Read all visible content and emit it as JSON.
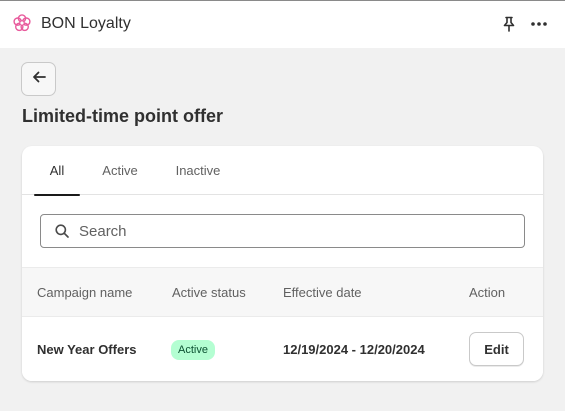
{
  "app": {
    "title": "BON Loyalty",
    "logo_icon": "flower-icon",
    "actions": [
      "pin-icon",
      "more-horizontal-icon"
    ]
  },
  "page": {
    "back_icon": "arrow-left-icon",
    "title": "Limited-time point offer"
  },
  "tabs": [
    {
      "label": "All",
      "selected": true
    },
    {
      "label": "Active",
      "selected": false
    },
    {
      "label": "Inactive",
      "selected": false
    }
  ],
  "search": {
    "placeholder": "Search",
    "value": "",
    "icon": "search-icon"
  },
  "table": {
    "headers": [
      "Campaign name",
      "Active status",
      "Effective date",
      "Action"
    ],
    "rows": [
      {
        "campaign_name": "New Year Offers",
        "status": "Active",
        "effective_date": "12/19/2024 - 12/20/2024",
        "action_label": "Edit"
      }
    ]
  },
  "colors": {
    "accent_underline": "#1a1a1a",
    "badge_bg": "#b4fed2",
    "badge_text": "#0c5132",
    "logo": "#e85a9c"
  }
}
